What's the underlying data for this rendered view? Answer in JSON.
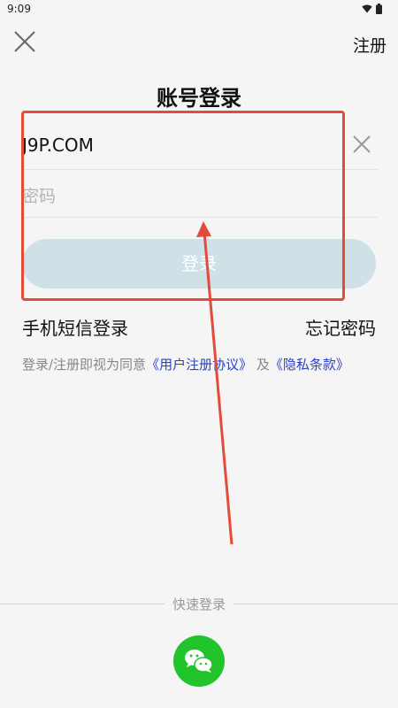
{
  "status_bar": {
    "time": "9:09"
  },
  "header": {
    "register_label": "注册"
  },
  "title": "账号登录",
  "form": {
    "account_value": "J9P.COM",
    "password_placeholder": "密码",
    "login_label": "登录"
  },
  "links": {
    "sms_login": "手机短信登录",
    "forgot_password": "忘记密码"
  },
  "agreement": {
    "prefix": "登录/注册即视为同意",
    "user_agreement": "《用户注册协议》",
    "and": "及",
    "privacy_policy": "《隐私条款》"
  },
  "quick_login": {
    "label": "快速登录"
  },
  "colors": {
    "accent_link": "#2a41c9",
    "login_button_disabled": "#cfe0e7",
    "wechat_green": "#22c42b",
    "annotation_red": "#e34b3a"
  },
  "icons": [
    "close-icon",
    "clear-icon",
    "wechat-icon",
    "wifi-icon",
    "battery-icon"
  ]
}
